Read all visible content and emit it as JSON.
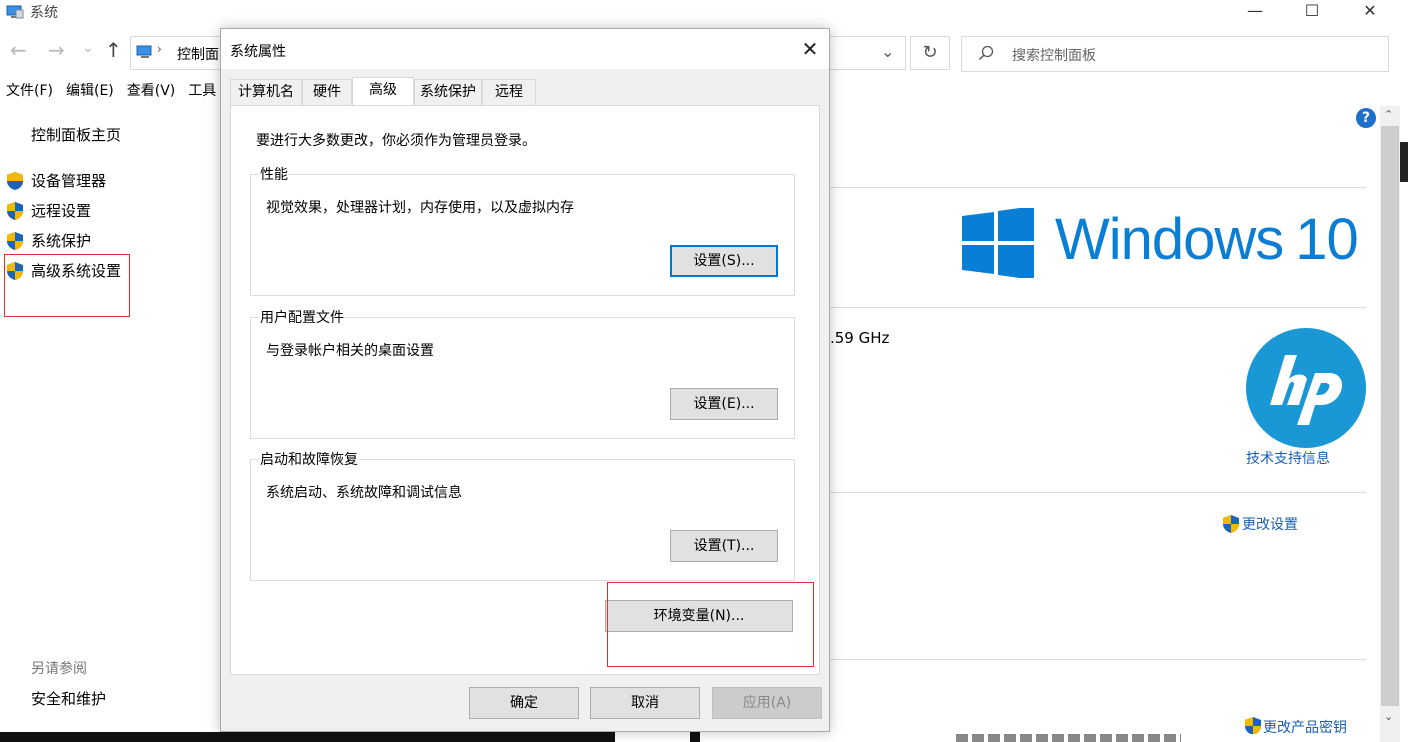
{
  "window": {
    "title": "系统",
    "caption_buttons": {
      "minimize": "—",
      "maximize": "☐",
      "close": "✕"
    }
  },
  "nav": {
    "address_text": "控制面",
    "search_placeholder": "搜索控制面板",
    "back_glyph": "←",
    "forward_glyph": "→",
    "recent_glyph": "⌄",
    "up_glyph": "↑",
    "dropdown_glyph": "⌄",
    "refresh_glyph": "↻"
  },
  "menu": {
    "file": "文件(F)",
    "edit": "编辑(E)",
    "view": "查看(V)",
    "tools": "工具"
  },
  "sidebar": {
    "home": "控制面板主页",
    "items": [
      "设备管理器",
      "远程设置",
      "系统保护",
      "高级系统设置"
    ],
    "see_also_title": "另请参阅",
    "see_also_items": [
      "安全和维护"
    ]
  },
  "right": {
    "help_glyph": "?",
    "cpu_text": ".59 GHz",
    "windows_logo_text": "Windows",
    "windows_version": "10",
    "support_link": "技术支持信息",
    "change_settings": "更改设置",
    "change_product_key": "更改产品密钥",
    "bottom_text": " "
  },
  "colors": {
    "accent": "#0078d7",
    "win_blue": "#0a7ed4",
    "hp_blue": "#1a98d5",
    "shield_yellow": "#f5b800",
    "shield_blue": "#1b64b8",
    "red_highlight": "#e0302b"
  },
  "dialog": {
    "title": "系统属性",
    "close_glyph": "✕",
    "tabs": [
      "计算机名",
      "硬件",
      "高级",
      "系统保护",
      "远程"
    ],
    "selected_tab": "高级",
    "admin_notice": "要进行大多数更改，你必须作为管理员登录。",
    "performance": {
      "title": "性能",
      "desc": "视觉效果，处理器计划，内存使用，以及虚拟内存",
      "button": "设置(S)..."
    },
    "profiles": {
      "title": "用户配置文件",
      "desc": "与登录帐户相关的桌面设置",
      "button": "设置(E)..."
    },
    "startup": {
      "title": "启动和故障恢复",
      "desc": "系统启动、系统故障和调试信息",
      "button": "设置(T)..."
    },
    "env_button": "环境变量(N)...",
    "ok": "确定",
    "cancel": "取消",
    "apply": "应用(A)"
  }
}
